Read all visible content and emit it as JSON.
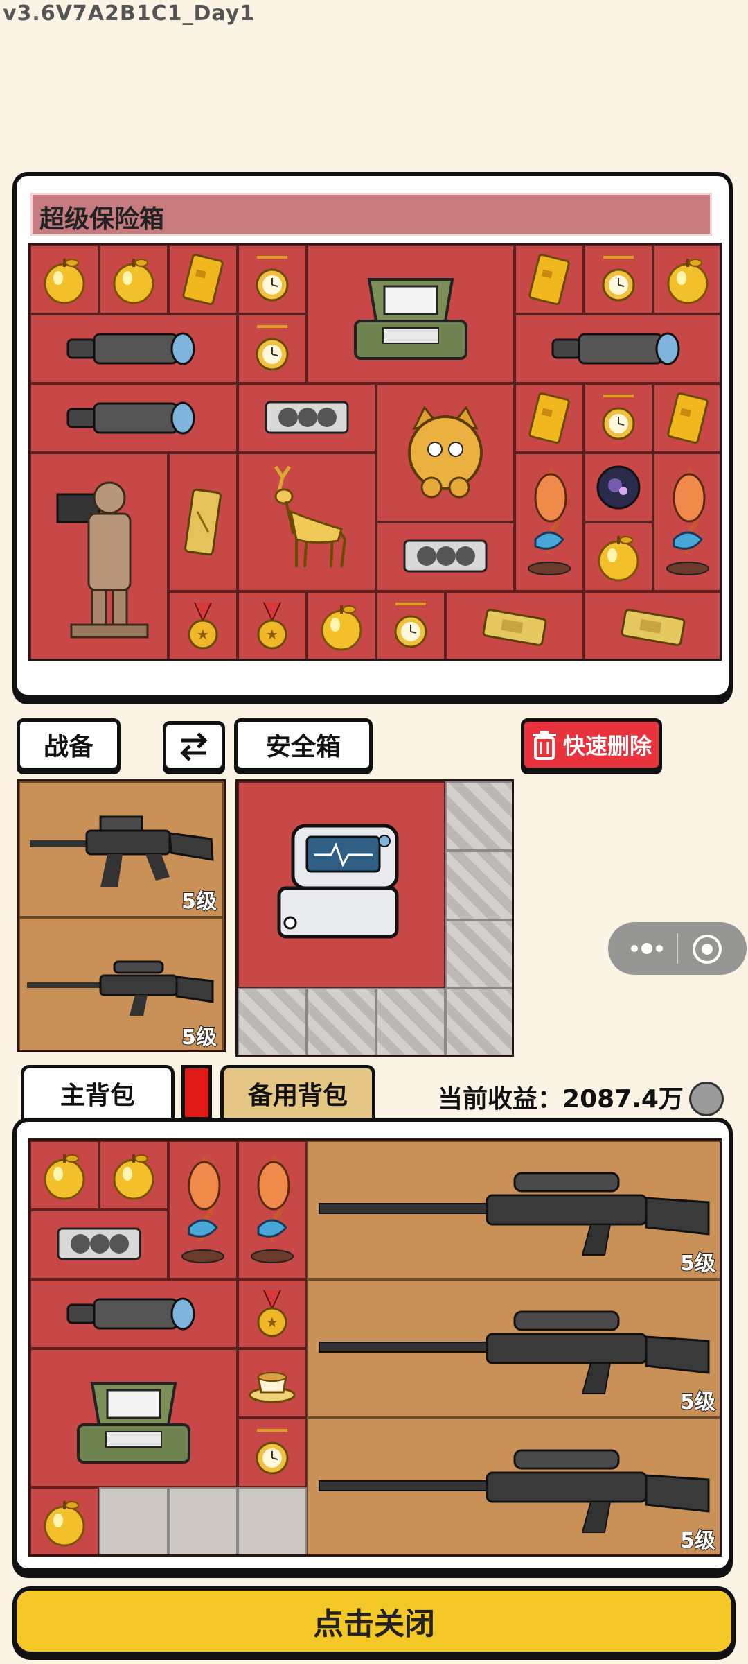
{
  "version": "v3.6V7A2B1C1_Day1",
  "vault": {
    "title": "超级保险箱",
    "items": [
      {
        "icon": "golden-apple-icon"
      },
      {
        "icon": "golden-apple-icon"
      },
      {
        "icon": "gold-card-icon"
      },
      {
        "icon": "pocket-watch-icon"
      },
      {
        "icon": "field-terminal-icon"
      },
      {
        "icon": "gold-card-icon"
      },
      {
        "icon": "pocket-watch-icon"
      },
      {
        "icon": "golden-apple-icon"
      },
      {
        "icon": "scope-icon"
      },
      {
        "icon": "pocket-watch-icon"
      },
      {
        "icon": "scope-icon"
      },
      {
        "icon": "scope-icon"
      },
      {
        "icon": "gpu-icon"
      },
      {
        "icon": "golden-cat-icon"
      },
      {
        "icon": "gold-card-icon"
      },
      {
        "icon": "pocket-watch-icon"
      },
      {
        "icon": "gold-card-icon"
      },
      {
        "icon": "terracotta-warrior-icon"
      },
      {
        "icon": "gold-bar-icon"
      },
      {
        "icon": "golden-deer-icon"
      },
      {
        "icon": "koi-statue-icon"
      },
      {
        "icon": "galaxy-orb-icon"
      },
      {
        "icon": "koi-statue-icon"
      },
      {
        "icon": "gpu-icon"
      },
      {
        "icon": "golden-apple-icon"
      },
      {
        "icon": "medal-icon"
      },
      {
        "icon": "medal-icon"
      },
      {
        "icon": "golden-apple-icon"
      },
      {
        "icon": "pocket-watch-icon"
      },
      {
        "icon": "gold-brick-icon"
      },
      {
        "icon": "gold-brick-icon"
      }
    ]
  },
  "toolbar": {
    "gear_tab": "战备",
    "swap_icon": "swap-arrows-icon",
    "safe_tab": "安全箱",
    "quick_delete": "快速删除"
  },
  "gear": {
    "weapons": [
      {
        "icon": "assault-rifle-icon",
        "level": "5级"
      },
      {
        "icon": "sniper-rifle-icon",
        "level": "5级"
      }
    ]
  },
  "safebox": {
    "item": {
      "icon": "medical-monitor-icon"
    }
  },
  "bag": {
    "main_tab": "主背包",
    "backup_tab": "备用背包",
    "earnings_label": "当前收益：",
    "earnings_value": "2087.4万",
    "weapons": [
      {
        "icon": "sniper-rifle-icon",
        "level": "5级"
      },
      {
        "icon": "sniper-rifle-icon",
        "level": "5级"
      },
      {
        "icon": "sniper-rifle-icon",
        "level": "5级"
      }
    ]
  },
  "close_button": "点击关闭",
  "colors": {
    "grid_red": "#c84848",
    "grid_tan": "#c99157",
    "delete_red": "#e8333c",
    "close_yellow": "#f4c826"
  }
}
